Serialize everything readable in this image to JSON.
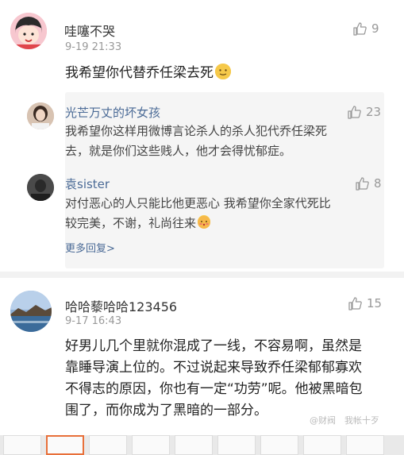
{
  "comment1": {
    "username": "哇噻不哭",
    "time": "9-19 21:33",
    "likes": "9",
    "text": "我希望你代替乔任梁去死",
    "emoji": "shy-smile"
  },
  "replies": [
    {
      "username": "光芒万丈的坏女孩",
      "likes": "23",
      "text_line1": "我希望你这样用微博言论杀人的杀人犯代乔任梁死",
      "text_line2": "去，就是你们这些贱人，他才会得忧郁症。"
    },
    {
      "username": "袁sister",
      "likes": "8",
      "text_line1": "对付恶心的人只能比他更恶心 我希望你全家代死比",
      "text_line2": "较完美，不谢，礼尚往来",
      "emoji": "blush"
    }
  ],
  "more_replies": "更多回复>",
  "comment2": {
    "username": "哈哈藜哈哈123456",
    "time": "9-17 16:43",
    "likes": "15",
    "text_line1": "好男儿几个里就你混成了一线，不容易啊，虽然是",
    "text_line2": "靠睡导演上位的。不过说起来导致乔任梁郁郁寡欢",
    "text_line3": "不得志的原因，你也有一定“功劳”呢。他被黑暗包",
    "text_line4": "围了，而你成为了黑暗的一部分。"
  },
  "watermark": "@财阀　我帐十歹",
  "colors": {
    "link": "#4a6a96",
    "muted": "#999999",
    "accent": "#e8703a"
  }
}
